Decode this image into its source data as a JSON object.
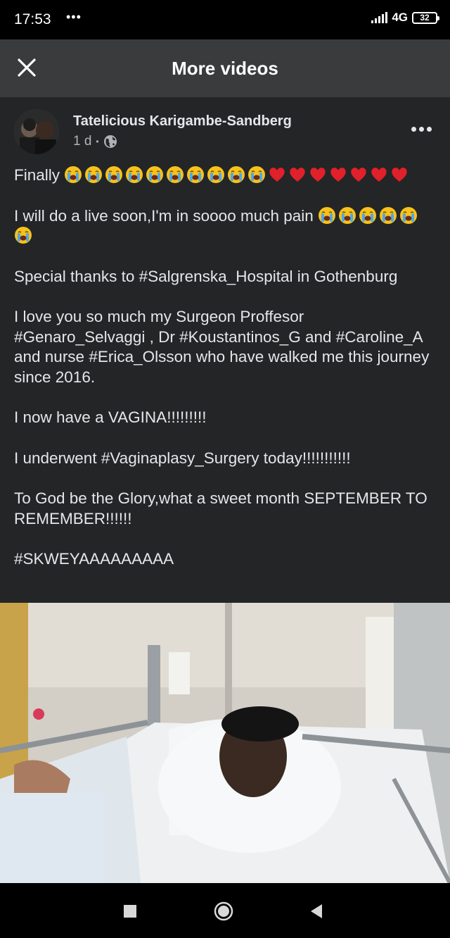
{
  "status_bar": {
    "time": "17:53",
    "dots": "•••",
    "network": "4G",
    "battery": "32"
  },
  "header": {
    "title": "More videos"
  },
  "post": {
    "author": "Tatelicious Karigambe-Sandberg",
    "time": "1 d",
    "separator": "•",
    "paragraphs": {
      "p1_text": "Finally",
      "p2_text": "I will do a live soon,I'm in soooo much pain",
      "p3": "Special thanks to #Salgrenska_Hospital in Gothenburg",
      "p4": "I love you so much my Surgeon Proffesor #Genaro_Selvaggi , Dr #Koustantinos_G and #Caroline_A and nurse #Erica_Olsson who have walked me this journey since 2016.",
      "p5": "I now have a VAGINA!!!!!!!!!",
      "p6": "I underwent #Vaginaplasy_Surgery today!!!!!!!!!!!",
      "p7": "To God be the Glory,what a sweet month SEPTEMBER TO REMEMBER!!!!!!",
      "p8": "#SKWEYAAAAAAAAA"
    }
  },
  "colors": {
    "background": "#242526",
    "header": "#3a3b3c",
    "text": "#e4e6eb",
    "meta": "#b0b3b8",
    "heart": "#e0202a",
    "emoji_face": "#f7c21c"
  },
  "icons": {
    "close": "close-icon",
    "globe": "globe-icon",
    "more": "more-options-icon",
    "crying": "crying-face-emoji",
    "heart": "red-heart-emoji",
    "nav_recents": "square-icon",
    "nav_home": "circle-home-icon",
    "nav_back": "back-triangle-icon"
  }
}
